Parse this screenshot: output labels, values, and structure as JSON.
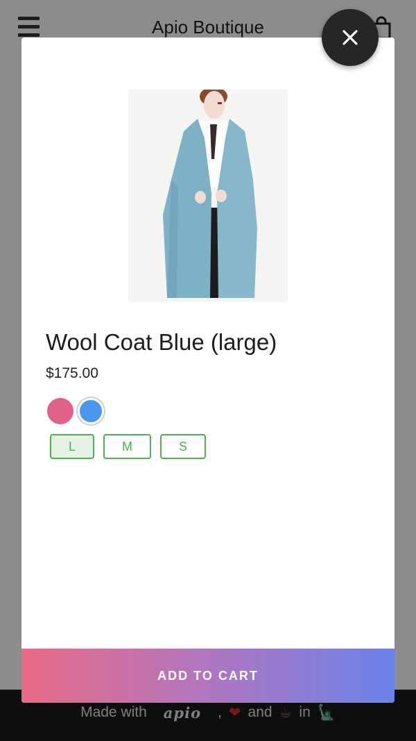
{
  "app": {
    "title": "Apio Boutique",
    "icons": {
      "menu": "hamburger-menu-icon",
      "cart": "shopping-bag-icon",
      "close": "close-icon"
    }
  },
  "product": {
    "name": "Wool Coat Blue (large)",
    "price": "$175.00",
    "image": "blue-wool-coat-photo",
    "colors": [
      {
        "name": "pink",
        "hex": "#e06088",
        "selected": false
      },
      {
        "name": "blue",
        "hex": "#4a98ec",
        "selected": true
      }
    ],
    "sizes": [
      {
        "label": "L",
        "selected": true
      },
      {
        "label": "M",
        "selected": false
      },
      {
        "label": "S",
        "selected": false
      }
    ]
  },
  "actions": {
    "add_to_cart": "ADD TO CART"
  },
  "footer": {
    "made_with": "Made with",
    "brand": "apio",
    "separator": ",",
    "and": "and",
    "in": "in",
    "emoji": {
      "heart": "❤",
      "coffee": "☕",
      "liberty": "🗽"
    }
  },
  "colors": {
    "accent_green": "#4caf50",
    "gradient_start": "#e86b86",
    "gradient_end": "#6b82ea",
    "overlay": "rgba(0,0,0,0.45)"
  }
}
